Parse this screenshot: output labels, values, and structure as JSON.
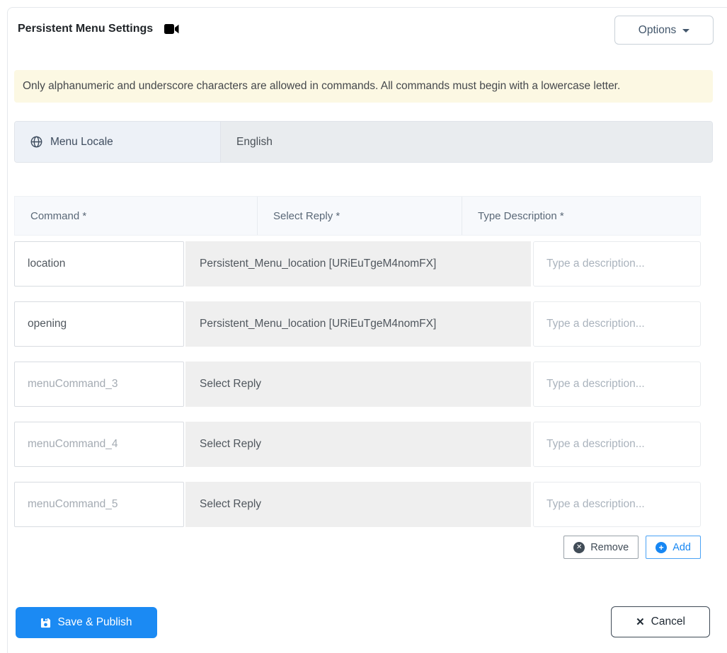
{
  "header": {
    "title": "Persistent Menu Settings",
    "options_label": "Options"
  },
  "banner": {
    "text": "Only alphanumeric and underscore characters are allowed in commands. All commands must begin with a lowercase letter."
  },
  "locale": {
    "label": "Menu Locale",
    "value": "English"
  },
  "table": {
    "headers": [
      "Command *",
      "Select Reply *",
      "Type Description *"
    ],
    "description_placeholder": "Type a description...",
    "rows": [
      {
        "command": "location",
        "command_is_placeholder": false,
        "reply": "Persistent_Menu_location [URiEuTgeM4nomFX]"
      },
      {
        "command": "opening",
        "command_is_placeholder": false,
        "reply": "Persistent_Menu_location [URiEuTgeM4nomFX]"
      },
      {
        "command": "menuCommand_3",
        "command_is_placeholder": true,
        "reply": "Select Reply"
      },
      {
        "command": "menuCommand_4",
        "command_is_placeholder": true,
        "reply": "Select Reply"
      },
      {
        "command": "menuCommand_5",
        "command_is_placeholder": true,
        "reply": "Select Reply"
      }
    ],
    "remove_label": "Remove",
    "add_label": "Add"
  },
  "footer": {
    "save_label": "Save & Publish",
    "cancel_label": "Cancel"
  },
  "icons": {
    "title": "camera-video-icon",
    "locale": "globe-icon",
    "options": "caret-down-icon",
    "remove": "x-circle-icon",
    "add": "plus-circle-icon",
    "save": "floppy-save-icon",
    "cancel": "x-icon"
  },
  "colors": {
    "primary_blue": "#1b8af3",
    "banner_bg": "#fcf8e3",
    "select_cell_bg": "#efefef",
    "locale_label_bg": "#edf1f7",
    "locale_value_bg": "#e9ecef",
    "table_header_bg": "#f7f9fc"
  }
}
